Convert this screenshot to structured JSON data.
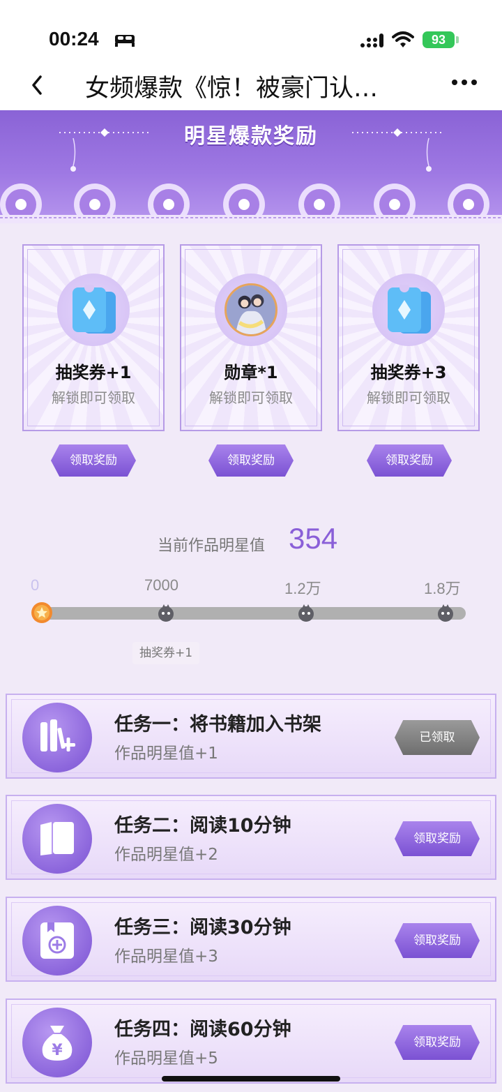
{
  "status_bar": {
    "time": "00:24",
    "battery": "93"
  },
  "nav": {
    "title": "女频爆款《惊！被豪门认…"
  },
  "banner": {
    "title": "明星爆款奖励"
  },
  "rewards": [
    {
      "title": "抽奖券+1",
      "subtitle": "解锁即可领取",
      "icon": "ticket-icon",
      "button": "领取奖励"
    },
    {
      "title": "勋章*1",
      "subtitle": "解锁即可领取",
      "icon": "medal-avatar",
      "button": "领取奖励"
    },
    {
      "title": "抽奖券+3",
      "subtitle": "解锁即可领取",
      "icon": "ticket-icon",
      "button": "领取奖励"
    }
  ],
  "progress": {
    "label": "当前作品明星值",
    "value": "354",
    "current": 354,
    "max": 18000,
    "ticks": [
      "0",
      "7000",
      "1.2万",
      "1.8万"
    ],
    "milestone_tag": "抽奖券+1"
  },
  "tasks": [
    {
      "title": "任务一：将书籍加入书架",
      "subtitle": "作品明星值+1",
      "button": "已领取",
      "claimed": true,
      "icon": "bookshelf-add-icon"
    },
    {
      "title": "任务二：阅读10分钟",
      "subtitle": "作品明星值+2",
      "button": "领取奖励",
      "claimed": false,
      "icon": "open-book-icon"
    },
    {
      "title": "任务三：阅读30分钟",
      "subtitle": "作品明星值+3",
      "button": "领取奖励",
      "claimed": false,
      "icon": "book-plus-icon"
    },
    {
      "title": "任务四：阅读60分钟",
      "subtitle": "作品明星值+5",
      "button": "领取奖励",
      "claimed": false,
      "icon": "money-bag-icon"
    }
  ],
  "colors": {
    "accent": "#8a5fd8",
    "progress_fill": "#f29a3b",
    "claimed_button": "#7e7e7e"
  }
}
